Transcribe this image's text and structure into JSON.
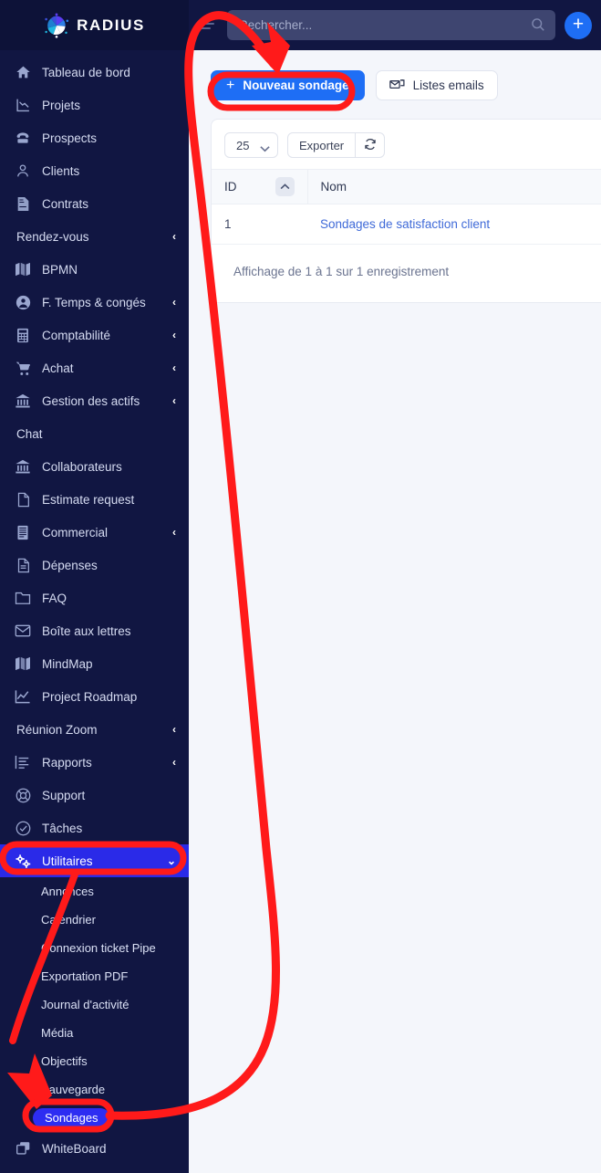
{
  "brand": {
    "name": "RADIUS"
  },
  "topbar": {
    "menu_icon": "hamburger-icon",
    "search_placeholder": "Rechercher...",
    "search_value": "",
    "search_icon": "search-icon",
    "add_label": "+"
  },
  "sidebar": {
    "items": [
      {
        "label": "Tableau de bord",
        "icon": "home-icon",
        "type": "item"
      },
      {
        "label": "Projets",
        "icon": "chart-decline-icon",
        "type": "item"
      },
      {
        "label": "Prospects",
        "icon": "telephone-icon",
        "type": "item"
      },
      {
        "label": "Clients",
        "icon": "user-icon",
        "type": "item"
      },
      {
        "label": "Contrats",
        "icon": "contract-document-icon",
        "type": "item"
      },
      {
        "label": "Rendez-vous",
        "icon": "",
        "type": "section",
        "chevron": "‹"
      },
      {
        "label": "BPMN",
        "icon": "map-icon",
        "type": "item"
      },
      {
        "label": "F. Temps & congés",
        "icon": "user-circle-icon",
        "type": "item",
        "chevron": "‹"
      },
      {
        "label": "Comptabilité",
        "icon": "calculator-icon",
        "type": "item",
        "chevron": "‹"
      },
      {
        "label": "Achat",
        "icon": "shopping-cart-icon",
        "type": "item",
        "chevron": "‹"
      },
      {
        "label": "Gestion des actifs",
        "icon": "bank-icon",
        "type": "item",
        "chevron": "‹"
      },
      {
        "label": "Chat",
        "icon": "",
        "type": "section"
      },
      {
        "label": "Collaborateurs",
        "icon": "bank-icon",
        "type": "item"
      },
      {
        "label": "Estimate request",
        "icon": "file-icon",
        "type": "item"
      },
      {
        "label": "Commercial",
        "icon": "receipt-icon",
        "type": "item",
        "chevron": "‹"
      },
      {
        "label": "Dépenses",
        "icon": "file-text-icon",
        "type": "item"
      },
      {
        "label": "FAQ",
        "icon": "folder-icon",
        "type": "item"
      },
      {
        "label": "Boîte aux lettres",
        "icon": "envelope-icon",
        "type": "item"
      },
      {
        "label": "MindMap",
        "icon": "map-icon",
        "type": "item"
      },
      {
        "label": "Project Roadmap",
        "icon": "line-chart-icon",
        "type": "item"
      },
      {
        "label": "Réunion Zoom",
        "icon": "",
        "type": "section",
        "chevron": "‹"
      },
      {
        "label": "Rapports",
        "icon": "report-icon",
        "type": "item",
        "chevron": "‹"
      },
      {
        "label": "Support",
        "icon": "life-ring-icon",
        "type": "item"
      },
      {
        "label": "Tâches",
        "icon": "check-circle-icon",
        "type": "item"
      },
      {
        "label": "Utilitaires",
        "icon": "gears-icon",
        "type": "item",
        "chevron": "⌄",
        "active": true
      }
    ],
    "subitems": [
      {
        "label": "Annonces"
      },
      {
        "label": "Calendrier"
      },
      {
        "label": "Connexion ticket Pipe"
      },
      {
        "label": "Exportation PDF"
      },
      {
        "label": "Journal d'activité"
      },
      {
        "label": "Média"
      },
      {
        "label": "Objectifs"
      },
      {
        "label": "Sauvegarde"
      },
      {
        "label": "Sondages",
        "selected": true
      }
    ],
    "trailing": [
      {
        "label": "WhiteBoard",
        "icon": "whiteboard-icon",
        "type": "item"
      }
    ]
  },
  "main": {
    "actions": {
      "new_survey_label": "Nouveau sondage",
      "new_survey_plus": "+",
      "email_lists_label": "Listes emails",
      "email_lists_icon": "mail-stack-icon"
    },
    "table": {
      "page_length": "25",
      "page_length_options": [
        "25"
      ],
      "export_label": "Exporter",
      "refresh_icon": "refresh-icon",
      "columns": [
        "ID",
        "Nom"
      ],
      "sort_icon": "chevron-up-icon",
      "rows": [
        {
          "id": "1",
          "nom": "Sondages de satisfaction client"
        }
      ],
      "footer": "Affichage de 1 à 1 sur 1 enregistrement"
    }
  },
  "annotations": {
    "highlight_color": "#ff1a1a",
    "targets": [
      "Utilitaires",
      "Sondages",
      "Nouveau sondage"
    ]
  }
}
